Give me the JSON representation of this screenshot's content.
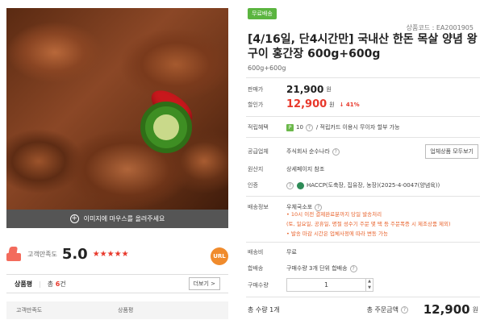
{
  "image": {
    "overlay_text": "이미지에 마우스를 올려주세요"
  },
  "rating": {
    "label": "고객만족도",
    "score": "5.0",
    "stars": "★★★★★",
    "url_badge": "URL"
  },
  "reviews": {
    "tab_label": "상품평",
    "count_prefix": "총",
    "count_value": "6",
    "count_suffix": "건",
    "more_label": "더보기 >",
    "columns": [
      "고객만족도",
      "상품평"
    ]
  },
  "product": {
    "badge": "무료배송",
    "code_label": "상품코드 : EA2001905",
    "title": "[4/16일, 단4시간만] 국내산 한돈 목살 양념 왕구이 홍간장 600g+600g",
    "subtitle": "600g+600g"
  },
  "price": {
    "orig_label": "판매가",
    "orig_value": "21,900",
    "sale_label": "할인가",
    "sale_value": "12,900",
    "currency": "원",
    "discount": "↓ 41%"
  },
  "details": {
    "points_label": "적립혜택",
    "points_icon": "P",
    "points_value": "10",
    "points_note": "/ 적립카드 이용시 무이자 할부 가능",
    "supplier_label": "공급업체",
    "supplier_value": "주식회사 순수나라",
    "supplier_button": "업체상품 모두보기",
    "origin_label": "원산지",
    "origin_value": "상세페이지 참조",
    "cert_label": "인증",
    "cert_value": "HACCP(도축장, 집유장, 농장)(2025-4-0047(양념육))",
    "shipping_label": "배송정보",
    "shipping_value": "우체국소포",
    "shipping_notes": [
      "• 10시 이전 결제완료분까지 당일 발송처리",
      "(토, 일요일, 공휴일, 명절 성수기 주문 몇 택 등 주문폭증 시 제조상품 제외)",
      "• 발송 마감 시간은 업체사정에 따라 변동 가능"
    ],
    "fee_label": "배송비",
    "fee_value": "무료",
    "bundle_label": "합배송",
    "bundle_value": "구매수량 3개 단위 합배송",
    "qty_label": "구매수량",
    "qty_value": "1"
  },
  "total": {
    "count_label": "총 수량 1개",
    "amount_label": "총 주문금액",
    "amount_value": "12,900",
    "currency": "원"
  }
}
